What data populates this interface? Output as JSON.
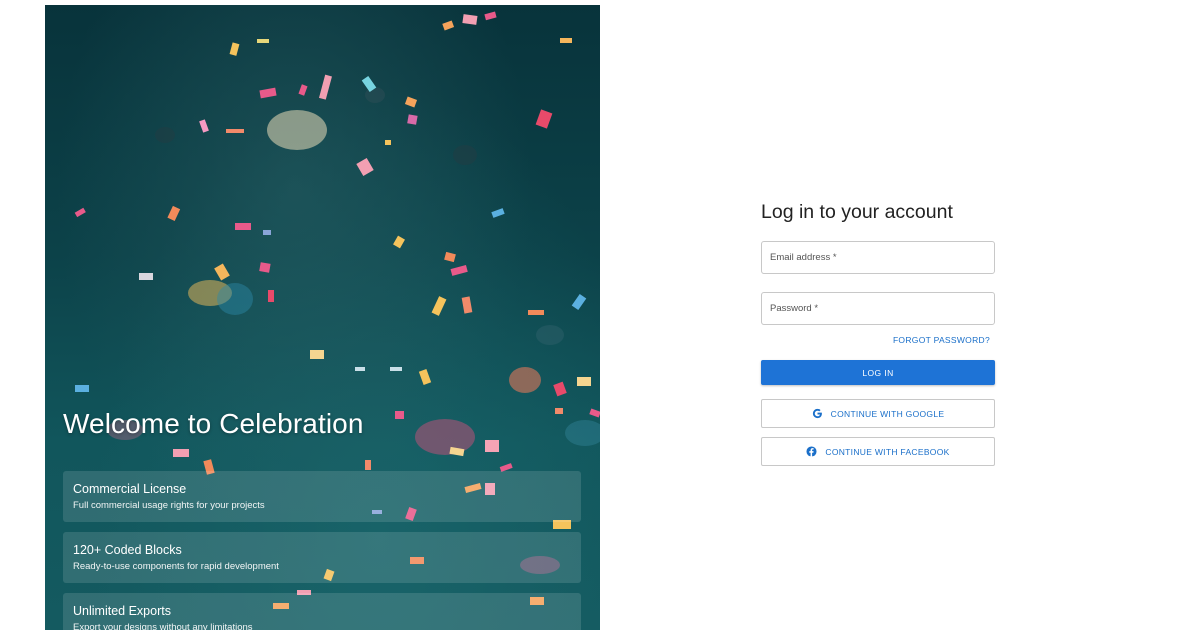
{
  "hero": {
    "title": "Welcome to Celebration",
    "features": [
      {
        "title": "Commercial License",
        "description": "Full commercial usage rights for your projects"
      },
      {
        "title": "120+ Coded Blocks",
        "description": "Ready-to-use components for rapid development"
      },
      {
        "title": "Unlimited Exports",
        "description": "Export your designs without any limitations"
      }
    ]
  },
  "login": {
    "title": "Log in to your account",
    "email_label": "Email address *",
    "password_label": "Password *",
    "forgot_label": "FORGOT PASSWORD?",
    "submit_label": "LOG IN",
    "google_label": "CONTINUE WITH GOOGLE",
    "facebook_label": "CONTINUE WITH FACEBOOK"
  },
  "colors": {
    "accent": "#1e73d6",
    "link": "#1a6fc9",
    "hero_dark": "#08333b",
    "hero_light": "#145a60"
  },
  "icons": {
    "google": "google-icon",
    "facebook": "facebook-icon"
  }
}
